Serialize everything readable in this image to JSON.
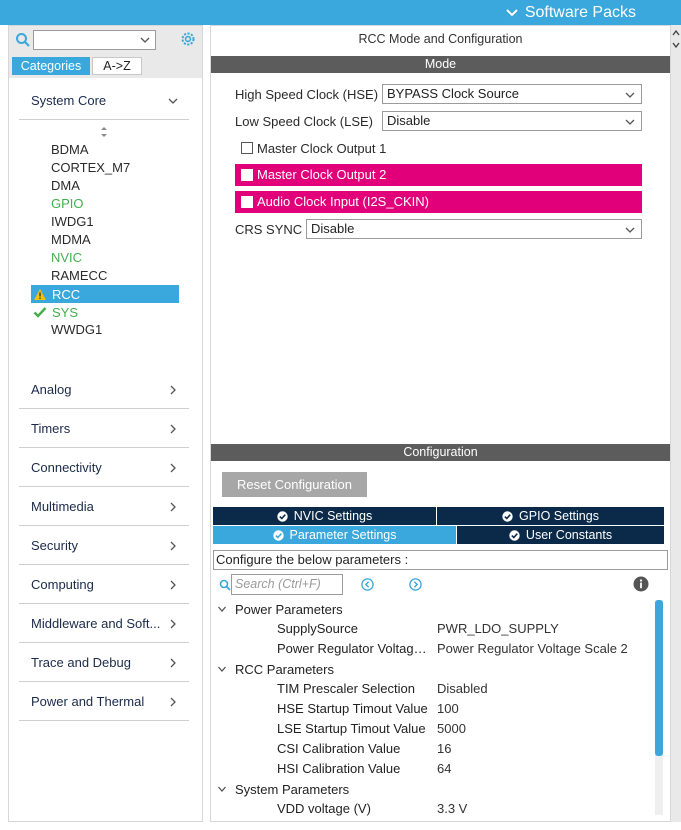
{
  "topbar": {
    "software_packs": "Software Packs"
  },
  "left": {
    "tabs": {
      "categories": "Categories",
      "az": "A->Z"
    },
    "system_core": {
      "label": "System Core",
      "items": [
        {
          "label": "BDMA",
          "status": "none"
        },
        {
          "label": "CORTEX_M7",
          "status": "none"
        },
        {
          "label": "DMA",
          "status": "none"
        },
        {
          "label": "GPIO",
          "status": "ok"
        },
        {
          "label": "IWDG1",
          "status": "none"
        },
        {
          "label": "MDMA",
          "status": "none"
        },
        {
          "label": "NVIC",
          "status": "ok"
        },
        {
          "label": "RAMECC",
          "status": "none"
        },
        {
          "label": "RCC",
          "status": "warning",
          "selected": true
        },
        {
          "label": "SYS",
          "status": "ok"
        },
        {
          "label": "WWDG1",
          "status": "none"
        }
      ]
    },
    "categories": [
      {
        "label": "Analog"
      },
      {
        "label": "Timers"
      },
      {
        "label": "Connectivity"
      },
      {
        "label": "Multimedia"
      },
      {
        "label": "Security"
      },
      {
        "label": "Computing"
      },
      {
        "label": "Middleware and Soft..."
      },
      {
        "label": "Trace and Debug"
      },
      {
        "label": "Power and Thermal"
      }
    ]
  },
  "right": {
    "title": "RCC Mode and Configuration",
    "mode_bar": "Mode",
    "hse": {
      "label": "High Speed Clock (HSE)",
      "value": "BYPASS Clock Source"
    },
    "lse": {
      "label": "Low Speed Clock (LSE)",
      "value": "Disable"
    },
    "mco1": {
      "label": "Master Clock Output 1"
    },
    "mco2": {
      "label": "Master Clock Output 2"
    },
    "i2s": {
      "label": "Audio Clock Input (I2S_CKIN)"
    },
    "crs": {
      "label": "CRS SYNC",
      "value": "Disable"
    },
    "config_bar": "Configuration",
    "reset_button": "Reset Configuration",
    "tabs": {
      "nvic": "NVIC Settings",
      "gpio": "GPIO Settings",
      "params": "Parameter Settings",
      "user": "User Constants"
    },
    "desc": "Configure the below parameters :",
    "search_placeholder": "Search (Ctrl+F)",
    "groups": [
      {
        "label": "Power Parameters",
        "params": [
          {
            "name": "SupplySource",
            "value": "PWR_LDO_SUPPLY"
          },
          {
            "name": "Power Regulator Voltage Scale",
            "value": "Power Regulator Voltage Scale 2"
          }
        ]
      },
      {
        "label": "RCC Parameters",
        "params": [
          {
            "name": "TIM Prescaler Selection",
            "value": "Disabled"
          },
          {
            "name": "HSE Startup Timout Value",
            "value": "100"
          },
          {
            "name": "LSE Startup Timout Value",
            "value": "5000"
          },
          {
            "name": "CSI Calibration Value",
            "value": "16"
          },
          {
            "name": "HSI Calibration Value",
            "value": "64"
          }
        ]
      },
      {
        "label": "System Parameters",
        "params": [
          {
            "name": "VDD voltage (V)",
            "value": "3.3 V"
          }
        ]
      }
    ]
  },
  "colors": {
    "accent_blue": "#3aa8dc",
    "dark_navy": "#0b2a4a",
    "pink_conflict": "#e2007a",
    "ok_green": "#43b04a",
    "warning_yellow": "#f2c200"
  }
}
